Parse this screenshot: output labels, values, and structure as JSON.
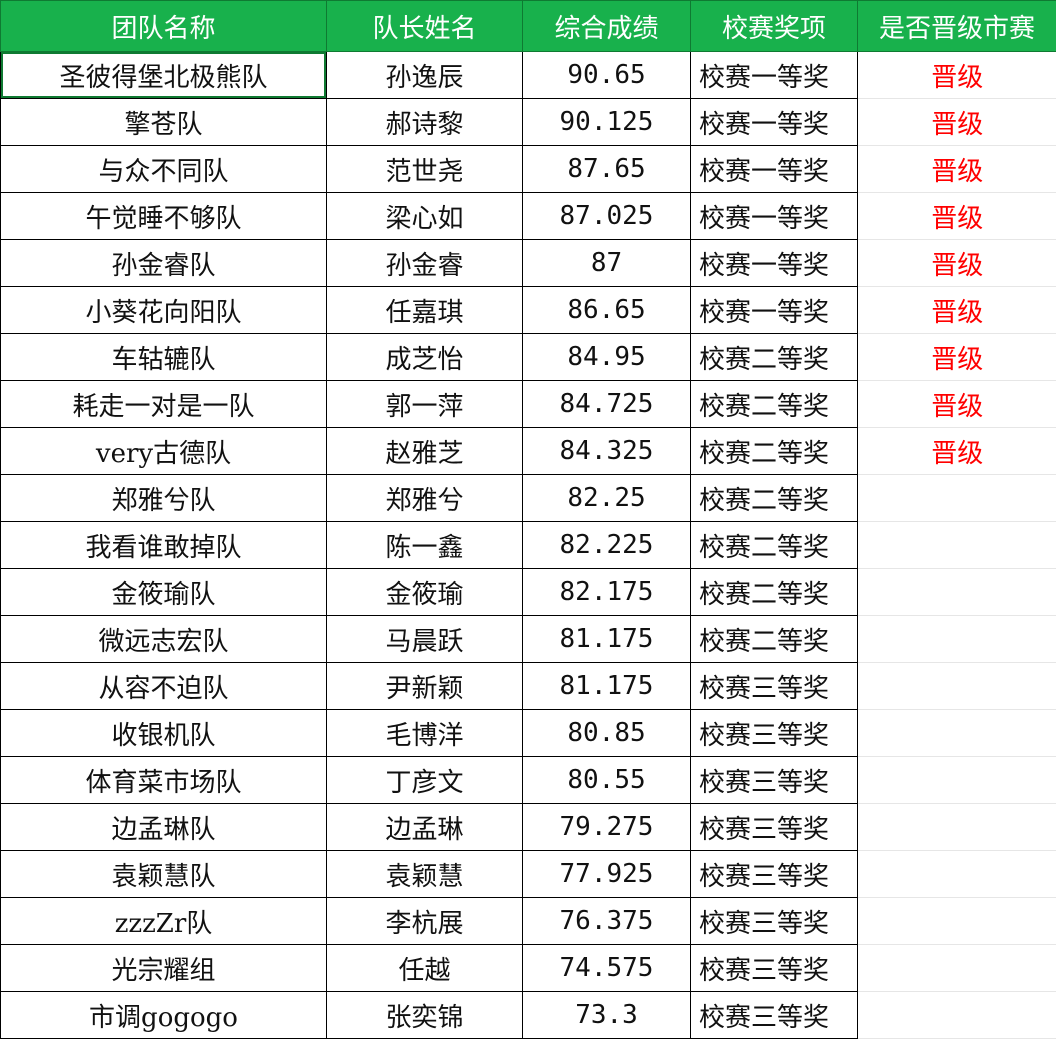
{
  "columns": [
    "团队名称",
    "队长姓名",
    "综合成绩",
    "校赛奖项",
    "是否晋级市赛"
  ],
  "rows": [
    {
      "team": "圣彼得堡北极熊队",
      "captain": "孙逸辰",
      "score": "90.65",
      "award": "校赛一等奖",
      "advance": "晋级"
    },
    {
      "team": "擎苍队",
      "captain": "郝诗黎",
      "score": "90.125",
      "award": "校赛一等奖",
      "advance": "晋级"
    },
    {
      "team": "与众不同队",
      "captain": "范世尧",
      "score": "87.65",
      "award": "校赛一等奖",
      "advance": "晋级"
    },
    {
      "team": "午觉睡不够队",
      "captain": "梁心如",
      "score": "87.025",
      "award": "校赛一等奖",
      "advance": "晋级"
    },
    {
      "team": "孙金睿队",
      "captain": "孙金睿",
      "score": "87",
      "award": "校赛一等奖",
      "advance": "晋级"
    },
    {
      "team": "小葵花向阳队",
      "captain": "任嘉琪",
      "score": "86.65",
      "award": "校赛一等奖",
      "advance": "晋级"
    },
    {
      "team": "车轱辘队",
      "captain": "成芝怡",
      "score": "84.95",
      "award": "校赛二等奖",
      "advance": "晋级"
    },
    {
      "team": "耗走一对是一队",
      "captain": "郭一萍",
      "score": "84.725",
      "award": "校赛二等奖",
      "advance": "晋级"
    },
    {
      "team": "very古德队",
      "captain": "赵雅芝",
      "score": "84.325",
      "award": "校赛二等奖",
      "advance": "晋级"
    },
    {
      "team": "郑雅兮队",
      "captain": "郑雅兮",
      "score": "82.25",
      "award": "校赛二等奖",
      "advance": ""
    },
    {
      "team": "我看谁敢掉队",
      "captain": "陈一鑫",
      "score": "82.225",
      "award": "校赛二等奖",
      "advance": ""
    },
    {
      "team": "金筱瑜队",
      "captain": "金筱瑜",
      "score": "82.175",
      "award": "校赛二等奖",
      "advance": ""
    },
    {
      "team": "微远志宏队",
      "captain": "马晨跃",
      "score": "81.175",
      "award": "校赛二等奖",
      "advance": ""
    },
    {
      "team": "从容不迫队",
      "captain": "尹新颖",
      "score": "81.175",
      "award": "校赛三等奖",
      "advance": ""
    },
    {
      "team": "收银机队",
      "captain": "毛博洋",
      "score": "80.85",
      "award": "校赛三等奖",
      "advance": ""
    },
    {
      "team": "体育菜市场队",
      "captain": "丁彦文",
      "score": "80.55",
      "award": "校赛三等奖",
      "advance": ""
    },
    {
      "team": "边孟琳队",
      "captain": "边孟琳",
      "score": "79.275",
      "award": "校赛三等奖",
      "advance": ""
    },
    {
      "team": "袁颖慧队",
      "captain": "袁颖慧",
      "score": "77.925",
      "award": "校赛三等奖",
      "advance": ""
    },
    {
      "team": "zzzZr队",
      "captain": "李杭展",
      "score": "76.375",
      "award": "校赛三等奖",
      "advance": ""
    },
    {
      "team": "光宗耀组",
      "captain": "任越",
      "score": "74.575",
      "award": "校赛三等奖",
      "advance": ""
    },
    {
      "team": "市调gogogo",
      "captain": "张奕锦",
      "score": "73.3",
      "award": "校赛三等奖",
      "advance": ""
    }
  ],
  "colors": {
    "header_bg": "#18b14c",
    "header_text": "#ffffff",
    "advance_text": "#ff0000"
  }
}
